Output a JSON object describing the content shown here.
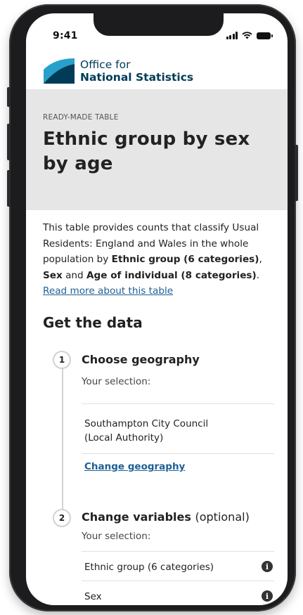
{
  "status": {
    "time": "9:41"
  },
  "header": {
    "org_line1": "Office for",
    "org_line2": "National Statistics"
  },
  "hero": {
    "eyebrow": "READY-MADE TABLE",
    "title": "Ethnic group by sex by age"
  },
  "intro": {
    "prefix": "This table provides counts that classify Usual Residents: England and Wales in the whole population by ",
    "var1": "Ethnic group (6 categories)",
    "sep1": ", ",
    "var2": "Sex",
    "sep2": " and ",
    "var3": "Age of individual (8 categories)",
    "suffix": ".",
    "read_more": "Read more about this table"
  },
  "get_data": {
    "title": "Get the data"
  },
  "steps": [
    {
      "number": "1",
      "title": "Choose geography",
      "selection_label": "Your selection:",
      "selection_line1": "Southampton City Council",
      "selection_line2": "(Local Authority)",
      "change_link": "Change geography"
    },
    {
      "number": "2",
      "title": "Change variables",
      "optional": "(optional)",
      "selection_label": "Your selection:",
      "variables": [
        "Ethnic group (6 categories)",
        "Sex"
      ]
    }
  ],
  "colors": {
    "link": "#206095",
    "ons_navy": "#003c57",
    "ons_teal": "#27a0cc",
    "hero_bg": "#e6e6e6"
  },
  "icons": {
    "info": "info-icon",
    "logo": "ons-logo-icon"
  }
}
